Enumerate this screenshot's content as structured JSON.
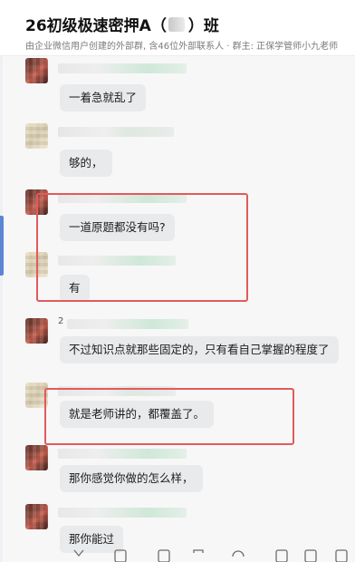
{
  "header": {
    "title_prefix": "26初级极速密押A（",
    "title_suffix": "）班",
    "subtitle": "由企业微信用户创建的外部群, 含46位外部联系人 · 群主: 正保学管师小九老师"
  },
  "messages": [
    {
      "avatar": "dark",
      "text": "一着急就乱了"
    },
    {
      "avatar": "light",
      "text": "够的，"
    },
    {
      "avatar": "dark",
      "text": "一道原题都没有吗?"
    },
    {
      "avatar": "light",
      "text": "有"
    },
    {
      "avatar": "dark",
      "name_prefix": "2",
      "text": "不过知识点就那些固定的，只有看自己掌握的程度了"
    },
    {
      "avatar": "light",
      "text": "就是老师讲的，都覆盖了。"
    },
    {
      "avatar": "dark",
      "text": "那你感觉你做的怎么样，"
    },
    {
      "avatar": "dark",
      "text": "那你能过"
    }
  ],
  "highlights": [
    {
      "color": "#e35a5a",
      "covers": "messages 3-4"
    },
    {
      "color": "#e35a5a",
      "covers": "message 6"
    }
  ],
  "toolbar_icons": [
    "emoji-icon",
    "folder-icon",
    "screenshot-icon",
    "image-icon",
    "chat-history-icon",
    "voice-call-icon",
    "video-icon",
    "more-icon"
  ]
}
